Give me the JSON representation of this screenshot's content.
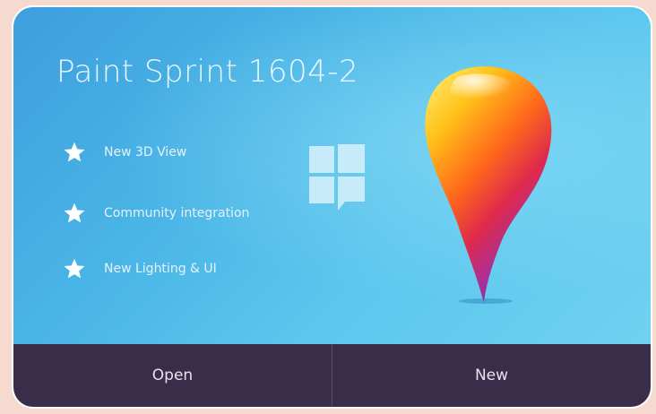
{
  "app": {
    "title": "Paint Sprint 1604-2"
  },
  "features": [
    {
      "label": "New 3D View",
      "icon": "star-icon"
    },
    {
      "label": "Community integration",
      "icon": "star-icon"
    },
    {
      "label": "New Lighting & UI",
      "icon": "star-icon"
    }
  ],
  "logos": {
    "os": "windows-logo-icon",
    "app": "paint-balloon-logo"
  },
  "buttons": {
    "open_label": "Open",
    "new_label": "New"
  },
  "colors": {
    "hero_blue": "#49b4e6",
    "button_bar": "#3a2d49",
    "text_light": "#eef8ff"
  }
}
